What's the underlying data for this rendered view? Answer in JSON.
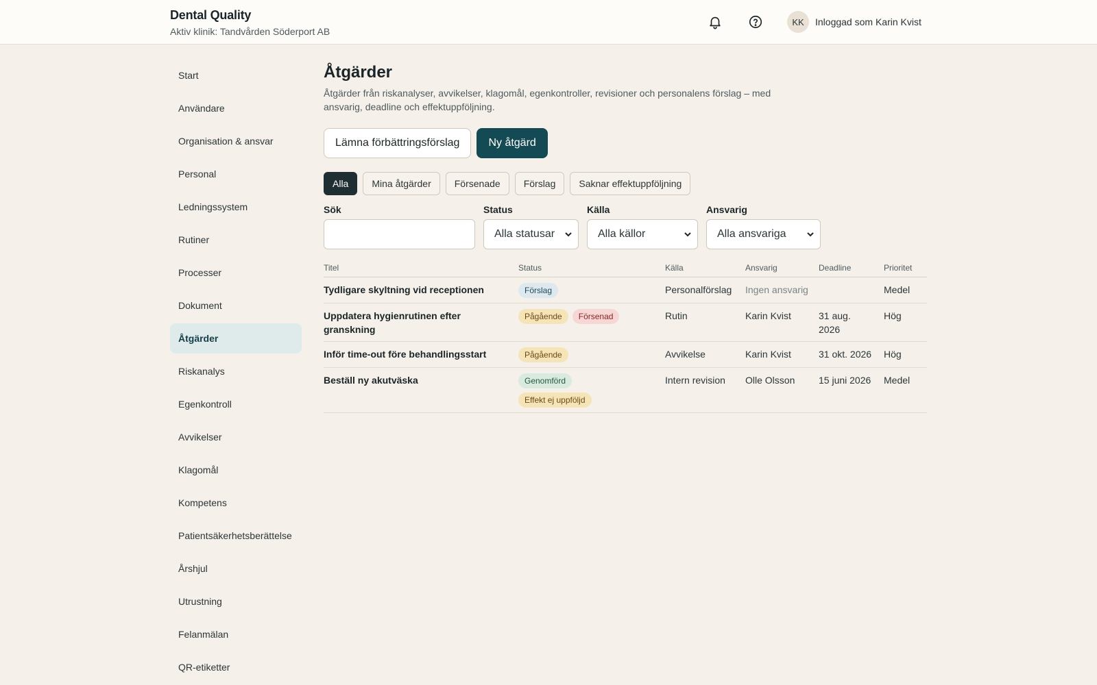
{
  "app": {
    "title": "Dental Quality",
    "clinic": "Aktiv klinik: Tandvården Söderport AB",
    "notifications_icon": "bell-icon",
    "help_icon": "help-circle-icon"
  },
  "user": {
    "initials": "KK",
    "label": "Inloggad som Karin Kvist"
  },
  "sidebar": {
    "items": [
      {
        "label": "Start",
        "active": false
      },
      {
        "label": "Användare",
        "active": false
      },
      {
        "label": "Organisation & ansvar",
        "active": false
      },
      {
        "label": "Personal",
        "active": false
      },
      {
        "label": "Ledningssystem",
        "active": false
      },
      {
        "label": "Rutiner",
        "active": false
      },
      {
        "label": "Processer",
        "active": false
      },
      {
        "label": "Dokument",
        "active": false
      },
      {
        "label": "Åtgärder",
        "active": true
      },
      {
        "label": "Riskanalys",
        "active": false
      },
      {
        "label": "Egenkontroll",
        "active": false
      },
      {
        "label": "Avvikelser",
        "active": false
      },
      {
        "label": "Klagomål",
        "active": false
      },
      {
        "label": "Kompetens",
        "active": false
      },
      {
        "label": "Patientsäkerhetsberättelse",
        "active": false
      },
      {
        "label": "Årshjul",
        "active": false
      },
      {
        "label": "Utrustning",
        "active": false
      },
      {
        "label": "Felanmälan",
        "active": false
      },
      {
        "label": "QR-etiketter",
        "active": false
      }
    ]
  },
  "page": {
    "title": "Åtgärder",
    "description": "Åtgärder från riskanalyser, avvikelser, klagomål, egenkontroller, revisioner och personalens förslag – med ansvarig, deadline och effektuppföljning.",
    "suggest_button": "Lämna förbättringsförslag",
    "new_button": "Ny åtgärd"
  },
  "chips": [
    {
      "label": "Alla",
      "active": true
    },
    {
      "label": "Mina åtgärder",
      "active": false
    },
    {
      "label": "Försenade",
      "active": false
    },
    {
      "label": "Förslag",
      "active": false
    },
    {
      "label": "Saknar effektuppföljning",
      "active": false
    }
  ],
  "filters": {
    "search_label": "Sök",
    "search_value": "",
    "status_label": "Status",
    "status_value": "Alla statusar",
    "source_label": "Källa",
    "source_value": "Alla källor",
    "owner_label": "Ansvarig",
    "owner_value": "Alla ansvariga"
  },
  "table": {
    "columns": [
      "Titel",
      "Status",
      "Källa",
      "Ansvarig",
      "Deadline",
      "Prioritet"
    ],
    "rows": [
      {
        "title": "Tydligare skyltning vid receptionen",
        "badges": [
          {
            "label": "Förslag",
            "tone": "blue"
          }
        ],
        "source": "Personalförslag",
        "owner": "Ingen ansvarig",
        "owner_muted": true,
        "deadline": "",
        "priority": "Medel"
      },
      {
        "title": "Uppdatera hygienrutinen efter granskning",
        "badges": [
          {
            "label": "Pågående",
            "tone": "amber"
          },
          {
            "label": "Försenad",
            "tone": "red"
          }
        ],
        "source": "Rutin",
        "owner": "Karin Kvist",
        "owner_muted": false,
        "deadline": "31 aug. 2026",
        "priority": "Hög"
      },
      {
        "title": "Inför time-out före behandlingsstart",
        "badges": [
          {
            "label": "Pågående",
            "tone": "amber"
          }
        ],
        "source": "Avvikelse",
        "owner": "Karin Kvist",
        "owner_muted": false,
        "deadline": "31 okt. 2026",
        "priority": "Hög"
      },
      {
        "title": "Beställ ny akutväska",
        "badges": [
          {
            "label": "Genomförd",
            "tone": "green"
          },
          {
            "label": "Effekt ej uppföljd",
            "tone": "amber"
          }
        ],
        "source": "Intern revision",
        "owner": "Olle Olsson",
        "owner_muted": false,
        "deadline": "15 juni 2026",
        "priority": "Medel"
      }
    ]
  },
  "colors": {
    "accent": "#134a53",
    "background": "#f5f1ea",
    "badge_blue_bg": "#dde9ee",
    "badge_blue_fg": "#1f4a5c",
    "badge_amber_bg": "#f6e4b9",
    "badge_amber_fg": "#6b4a12",
    "badge_red_bg": "#f7d6d6",
    "badge_red_fg": "#8a2326",
    "badge_green_bg": "#d9eadf",
    "badge_green_fg": "#23583a"
  }
}
